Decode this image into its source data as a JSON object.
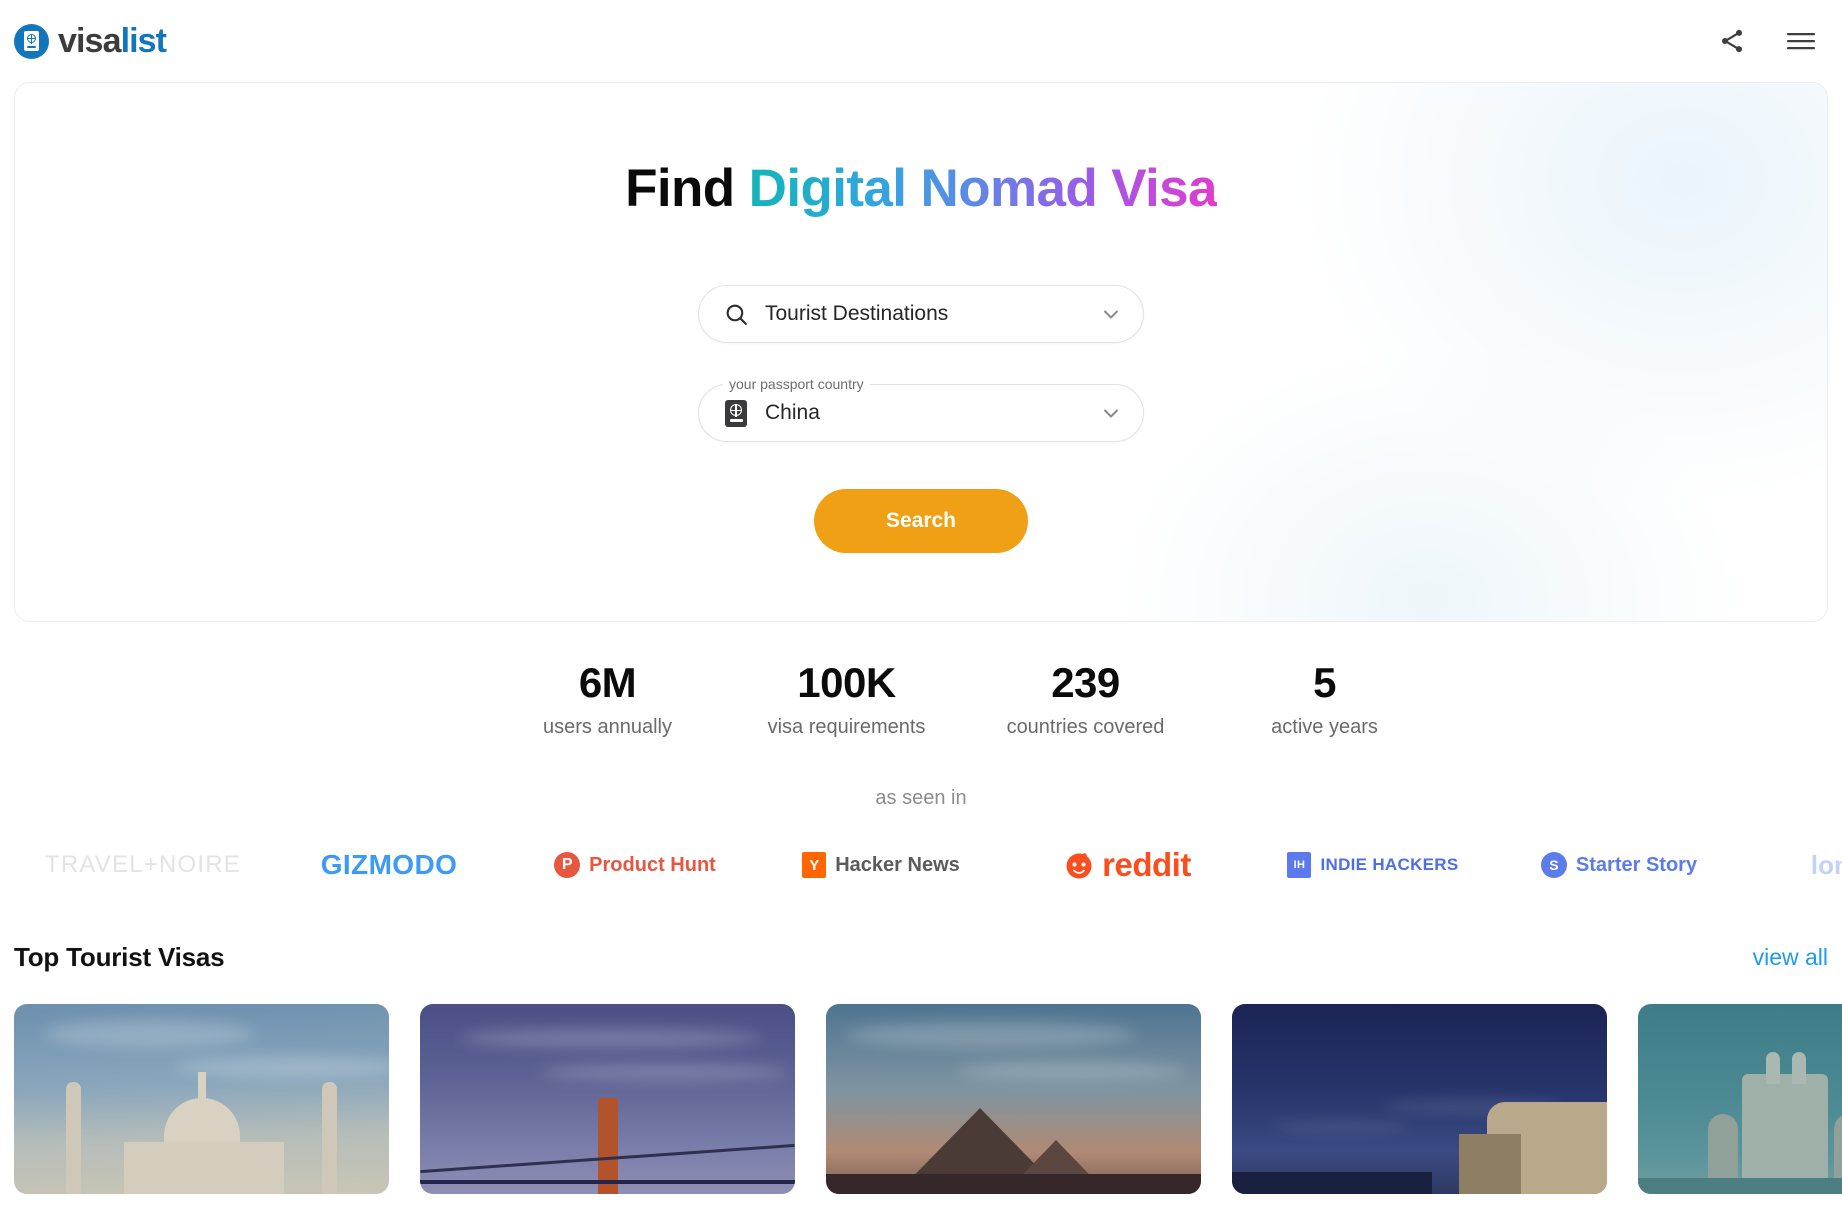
{
  "header": {
    "brand_visa": "visa",
    "brand_list": "list",
    "share_icon": "share-icon",
    "menu_icon": "hamburger-menu-icon"
  },
  "hero": {
    "title_static": "Find ",
    "title_gradient": "Digital Nomad Visa",
    "search_field": {
      "icon": "search-icon",
      "value": "Tourist Destinations",
      "chevron": "chevron-down-icon"
    },
    "country_field": {
      "icon": "passport-icon",
      "label": "your passport country",
      "value": "China",
      "chevron": "chevron-down-icon"
    },
    "search_button": "Search",
    "accent_color": "#F0A014"
  },
  "stats": [
    {
      "number": "6M",
      "label": "users annually"
    },
    {
      "number": "100K",
      "label": "visa requirements"
    },
    {
      "number": "239",
      "label": "countries covered"
    },
    {
      "number": "5",
      "label": "active years"
    }
  ],
  "press": {
    "label": "as seen in",
    "items": [
      {
        "name": "TRAVEL+NOIRE",
        "mark": ""
      },
      {
        "name": "GIZMODO",
        "mark": ""
      },
      {
        "name": "Product Hunt",
        "mark": "P"
      },
      {
        "name": "Hacker News",
        "mark": "Y"
      },
      {
        "name": "reddit",
        "mark": ""
      },
      {
        "name": "INDIE HACKERS",
        "mark": "IH"
      },
      {
        "name": "Starter Story",
        "mark": "S"
      },
      {
        "name": "lonely",
        "mark": ""
      }
    ]
  },
  "section": {
    "title": "Top Tourist Visas",
    "view_all": "view all"
  },
  "cards": [
    {
      "alt": "taj-mahal"
    },
    {
      "alt": "golden-gate-bridge"
    },
    {
      "alt": "volcano-landscape"
    },
    {
      "alt": "night-cityscape"
    },
    {
      "alt": "dubai-atlantis"
    }
  ]
}
